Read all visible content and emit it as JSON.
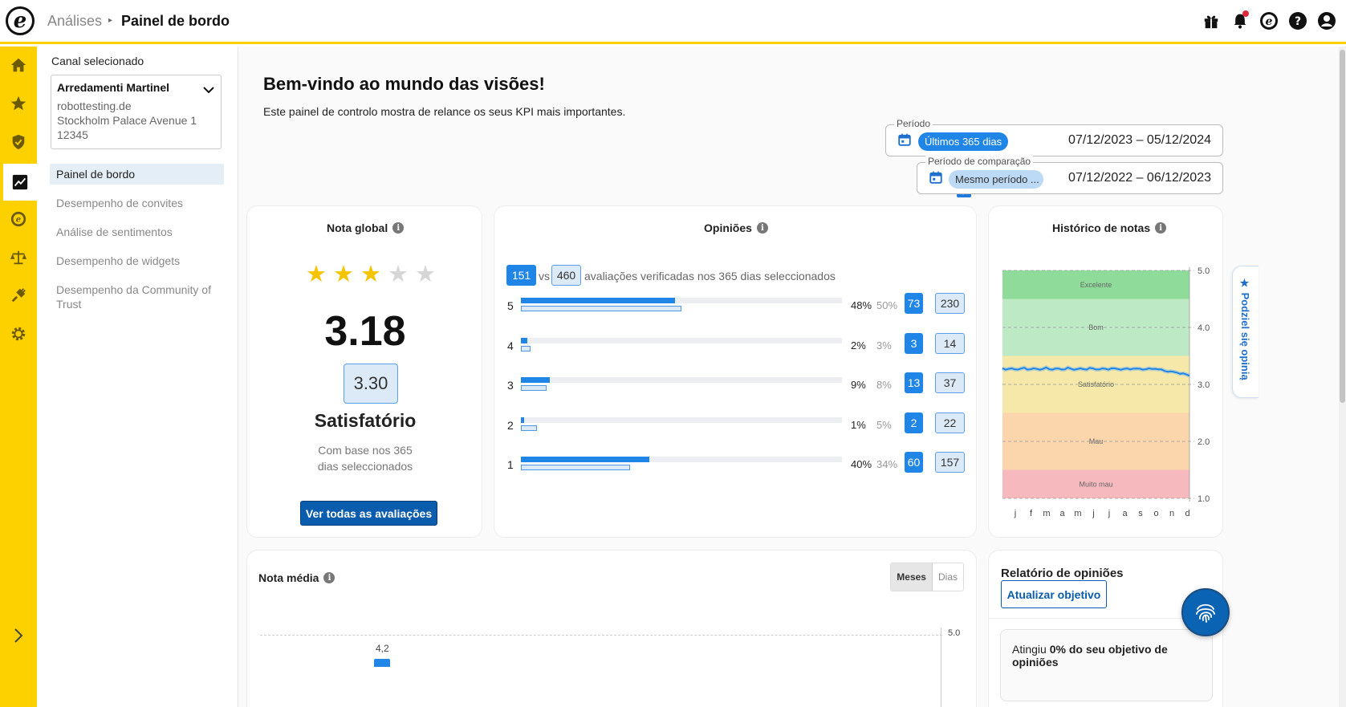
{
  "header": {
    "breadcrumb_parent": "Análises",
    "breadcrumb_separator": "▸",
    "breadcrumb_current": "Painel de bordo",
    "icons": [
      "gift-icon",
      "bell-icon",
      "brand-icon",
      "help-icon",
      "account-icon"
    ]
  },
  "rail": {
    "icons": [
      "home-icon",
      "star-icon",
      "shield-check-icon",
      "analytics-icon",
      "brand-coin-icon",
      "scales-icon",
      "plug-icon",
      "gear-icon"
    ],
    "expand_icon": "chevron-right-icon"
  },
  "sidenav": {
    "channel_label": "Canal selecionado",
    "channel": {
      "name": "Arredamenti Martinel",
      "domain": "robottesting.de",
      "address": "Stockholm Palace Avenue 1",
      "postcode": "12345"
    },
    "items": [
      {
        "label": "Painel de bordo",
        "active": true
      },
      {
        "label": "Desempenho de convites",
        "active": false
      },
      {
        "label": "Análise de sentimentos",
        "active": false
      },
      {
        "label": "Desempenho de widgets",
        "active": false
      },
      {
        "label": "Desempenho da Community of Trust",
        "active": false
      }
    ]
  },
  "main": {
    "welcome_title": "Bem-vindo ao mundo das visões!",
    "welcome_subtitle": "Este painel de controlo mostra de relance os seus KPI mais importantes.",
    "period": {
      "legend": "Período",
      "chip": "Últimos 365 dias",
      "dates": "07/12/2023 – 05/12/2024"
    },
    "comparison": {
      "legend": "Período de comparação",
      "chip": "Mesmo período ...",
      "dates": "07/12/2022 – 06/12/2023",
      "checked": true
    },
    "global": {
      "title": "Nota global",
      "stars_filled": 3,
      "stars_total": 5,
      "score": "3.18",
      "comparison_score": "3.30",
      "label": "Satisfatório",
      "based_on_line1": "Com base nos 365",
      "based_on_line2": "dias seleccionados",
      "button": "Ver todas as avaliações"
    },
    "opinions": {
      "title": "Opiniões",
      "current_total": "151",
      "vs": "vs",
      "comparison_total": "460",
      "summary": "avaliações verificadas nos 365 dias seleccionados",
      "rows": [
        {
          "star": "5",
          "pct": "48%",
          "pct_cmp": "50%",
          "count": "73",
          "count_cmp": "230",
          "fill": 0.48,
          "fill_cmp": 0.5
        },
        {
          "star": "4",
          "pct": "2%",
          "pct_cmp": "3%",
          "count": "3",
          "count_cmp": "14",
          "fill": 0.02,
          "fill_cmp": 0.03
        },
        {
          "star": "3",
          "pct": "9%",
          "pct_cmp": "8%",
          "count": "13",
          "count_cmp": "37",
          "fill": 0.09,
          "fill_cmp": 0.08
        },
        {
          "star": "2",
          "pct": "1%",
          "pct_cmp": "5%",
          "count": "2",
          "count_cmp": "22",
          "fill": 0.01,
          "fill_cmp": 0.05
        },
        {
          "star": "1",
          "pct": "40%",
          "pct_cmp": "34%",
          "count": "60",
          "count_cmp": "157",
          "fill": 0.4,
          "fill_cmp": 0.34
        }
      ]
    },
    "history": {
      "title": "Histórico de notas",
      "bands": [
        {
          "label": "Excelente",
          "from": 4.5,
          "to": 5.0,
          "color": "#8fdc9a"
        },
        {
          "label": "Bom",
          "from": 3.5,
          "to": 4.5,
          "color": "#bdeac4"
        },
        {
          "label": "Satisfatório",
          "from": 2.5,
          "to": 3.5,
          "color": "#f5e8a8"
        },
        {
          "label": "Mau",
          "from": 1.5,
          "to": 2.5,
          "color": "#fbd6ad"
        },
        {
          "label": "Muito mau",
          "from": 1.0,
          "to": 1.5,
          "color": "#f6b9bd"
        }
      ],
      "y_ticks": [
        "5.0",
        "4.0",
        "3.0",
        "2.0",
        "1.0"
      ],
      "months": [
        "j",
        "f",
        "m",
        "a",
        "m",
        "j",
        "j",
        "a",
        "s",
        "o",
        "n",
        "d"
      ],
      "series_color": "#1f85e6"
    },
    "average": {
      "title": "Nota média",
      "toggle_months": "Meses",
      "toggle_days": "Dias",
      "y_top": "5.0",
      "first_label": "4,2"
    },
    "report": {
      "title": "Relatório de opiniões",
      "button": "Atualizar objetivo",
      "reached_prefix": "Atingiu ",
      "reached_bold": "0% do seu objetivo de opiniões"
    }
  },
  "side_tab": {
    "label": "★ Podziel się opinią"
  },
  "fab_icon": "fingerprint-icon"
}
